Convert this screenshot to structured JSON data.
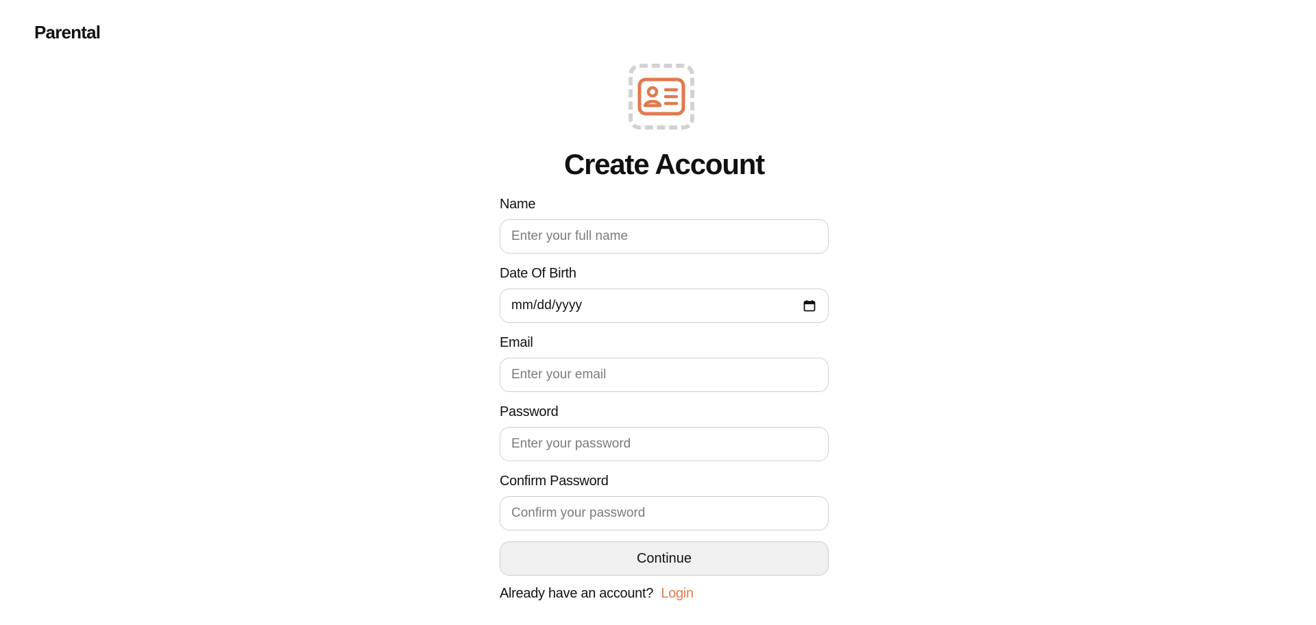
{
  "brand": {
    "name": "Parental"
  },
  "header": {
    "title": "Create Account",
    "icon": "contact-card-icon",
    "accent_color": "#e07a4f"
  },
  "form": {
    "name": {
      "label": "Name",
      "placeholder": "Enter your full name",
      "value": ""
    },
    "dob": {
      "label": "Date Of Birth",
      "placeholder": "mm/dd/yyyy",
      "icon": "calendar-icon"
    },
    "email": {
      "label": "Email",
      "placeholder": "Enter your email",
      "value": ""
    },
    "password": {
      "label": "Password",
      "placeholder": "Enter your password",
      "value": ""
    },
    "confirm_password": {
      "label": "Confirm Password",
      "placeholder": "Confirm your password",
      "value": ""
    },
    "continue_label": "Continue"
  },
  "footer": {
    "prompt": "Already have an account?",
    "login_label": "Login",
    "link_color": "#e07a4f"
  }
}
